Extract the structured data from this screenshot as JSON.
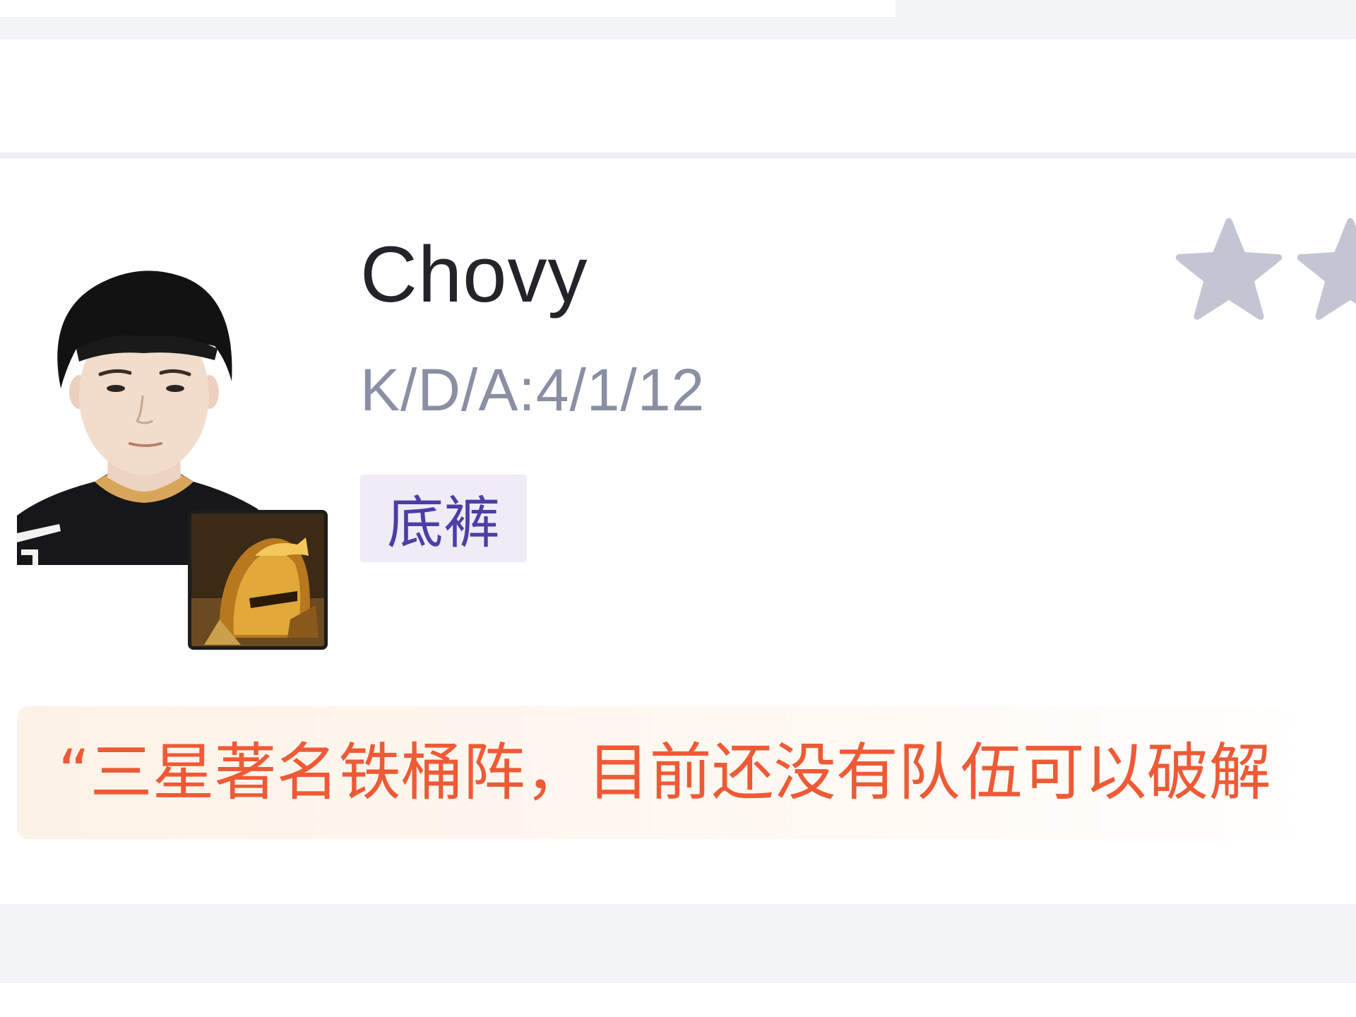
{
  "player": {
    "name": "Chovy",
    "kda": "K/D/A:4/1/12",
    "tag": "底裤",
    "quote": "“三星著名铁桶阵，目前还没有队伍可以破解",
    "rating": {
      "stars_visible": 2,
      "star_color": "#c3c6d2"
    }
  },
  "icons": {
    "avatar": "player-photo",
    "champion": "champion-helmet-icon",
    "star": "star-icon"
  },
  "colors": {
    "name": "#23242a",
    "kda": "#8a8fa3",
    "tag_text": "#4c3ea6",
    "tag_bg": "#efecf6",
    "quote_text": "#ee5a36",
    "quote_bg": "#fdf2e7"
  }
}
